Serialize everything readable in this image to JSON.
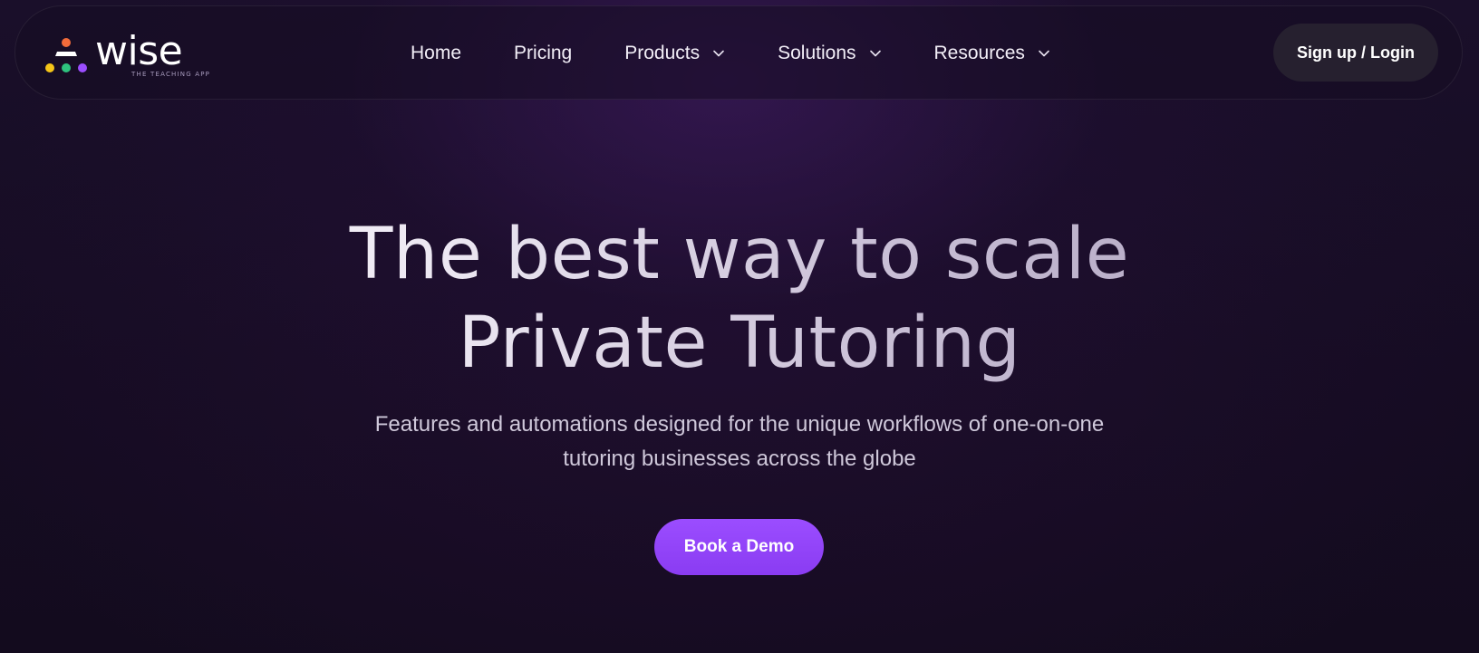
{
  "brand": {
    "name": "wise",
    "tagline": "THE TEACHING APP",
    "dot_colors": [
      "#f26b3a",
      "#f5c518",
      "#2ec27e",
      "#9b4dff"
    ]
  },
  "nav": {
    "items": [
      {
        "label": "Home",
        "has_dropdown": false
      },
      {
        "label": "Pricing",
        "has_dropdown": false
      },
      {
        "label": "Products",
        "has_dropdown": true,
        "icon": "chevron-down-icon"
      },
      {
        "label": "Solutions",
        "has_dropdown": true,
        "icon": "chevron-down-icon"
      },
      {
        "label": "Resources",
        "has_dropdown": true,
        "icon": "chevron-down-icon"
      }
    ],
    "signup_label": "Sign up / Login"
  },
  "hero": {
    "title_line1": "The best way to scale",
    "title_line2": "Private Tutoring",
    "subtitle": "Features and automations designed for the unique workflows of one-on-one tutoring businesses across the globe",
    "cta_label": "Book a Demo",
    "accent_color": "#9b4dff"
  }
}
